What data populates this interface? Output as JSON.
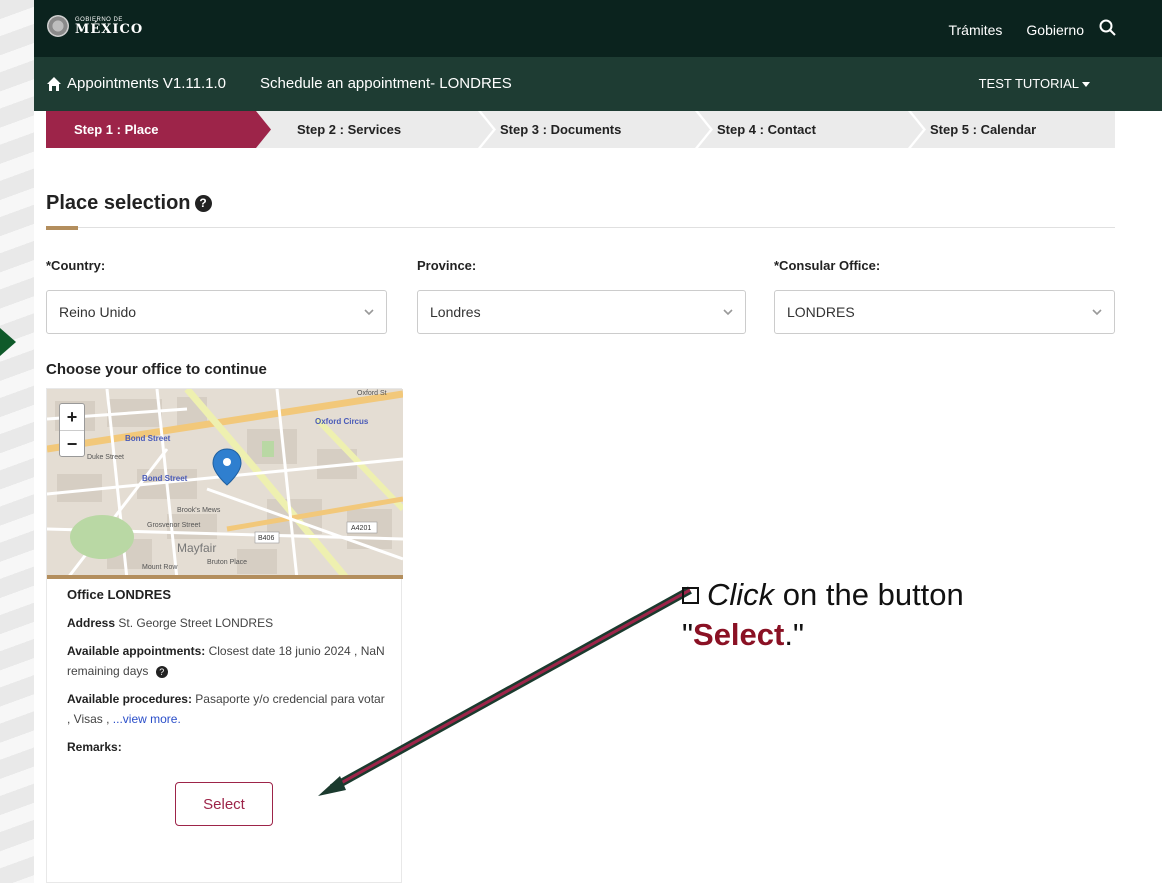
{
  "gov": {
    "logo_small": "GOBIERNO DE",
    "logo_big": "MÉXICO",
    "links": [
      "Trámites",
      "Gobierno"
    ]
  },
  "app": {
    "title": "Appointments V1.11.1.0",
    "subtitle": "Schedule an appointment- LONDRES",
    "user": "TEST TUTORIAL"
  },
  "steps": [
    {
      "label": "Step 1 : Place",
      "active": true
    },
    {
      "label": "Step 2 : Services",
      "active": false
    },
    {
      "label": "Step 3 : Documents",
      "active": false
    },
    {
      "label": "Step 4 : Contact",
      "active": false
    },
    {
      "label": "Step 5 : Calendar",
      "active": false
    }
  ],
  "place": {
    "title": "Place selection",
    "country_label": "*Country:",
    "country_value": "Reino Unido",
    "province_label": "Province:",
    "province_value": "Londres",
    "office_label": "*Consular Office:",
    "office_value": "LONDRES",
    "choose_label": "Choose your office to continue"
  },
  "map": {
    "labels": [
      "Oxford Circus",
      "Bond Street",
      "Bond Street",
      "Mayfair",
      "Brook's Mews",
      "Grosvenor Street",
      "B406",
      "A4201",
      "Oxford St",
      "Mount Row",
      "Bruton Place",
      "Duke Street"
    ],
    "zoom_in": "+",
    "zoom_out": "−"
  },
  "office": {
    "name": "Office LONDRES",
    "address_label": "Address",
    "address_value": " St. George Street LONDRES",
    "appointments_label": "Available appointments:",
    "appointments_value": " Closest date 18 junio 2024 , NaN remaining days",
    "procedures_label": "Available procedures:",
    "procedures_value": " Pasaporte y/o credencial para votar ,  Visas ,  ",
    "view_more": "...view more.",
    "remarks_label": "Remarks:",
    "select_label": "Select"
  },
  "annotation": {
    "click": "Click",
    "rest": " on the button",
    "quote_open": "\"",
    "select": "Select",
    "quote_close": ".\""
  },
  "colors": {
    "gov_bar": "#0b231e",
    "app_bar": "#1e3c33",
    "accent": "#9d2449",
    "gold": "#b38e5d"
  }
}
